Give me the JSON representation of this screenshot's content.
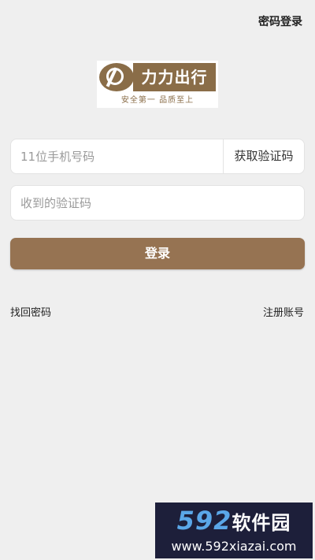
{
  "header": {
    "password_login": "密码登录"
  },
  "logo": {
    "brand": "力力出行",
    "slogan": "安全第一 品质至上"
  },
  "form": {
    "phone_placeholder": "11位手机号码",
    "get_code_label": "获取验证码",
    "code_placeholder": "收到的验证码",
    "login_label": "登录"
  },
  "links": {
    "forgot_password": "找回密码",
    "register": "注册账号"
  },
  "watermark": {
    "numbers": "592",
    "brand": "软件园",
    "url": "www.592xiazai.com"
  },
  "colors": {
    "accent": "#967352",
    "background": "#efefef"
  }
}
